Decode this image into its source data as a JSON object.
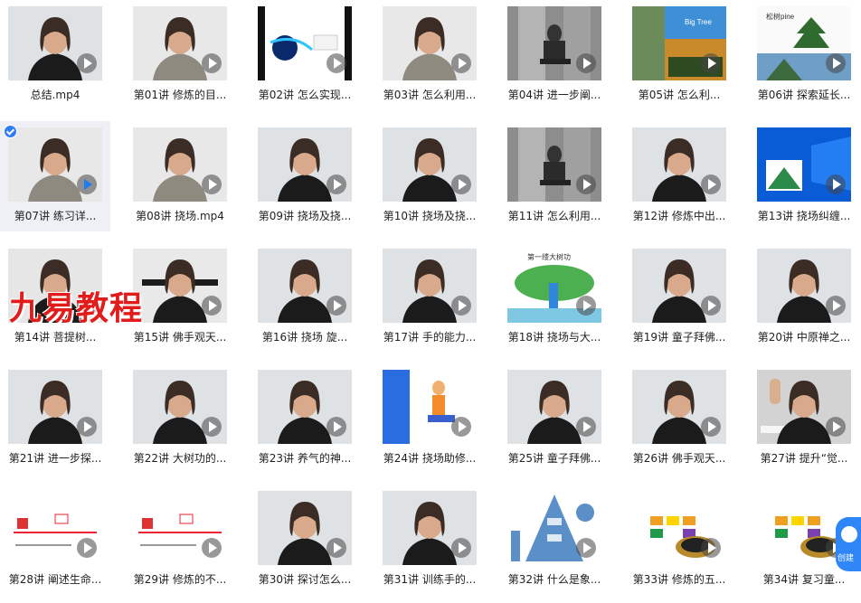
{
  "items": [
    {
      "label": "总结.mp4",
      "style": "person",
      "selected": false
    },
    {
      "label": "第01讲 修炼的目...",
      "style": "person-light",
      "selected": false
    },
    {
      "label": "第02讲 怎么实现...",
      "style": "slide-blue",
      "selected": false
    },
    {
      "label": "第03讲 怎么利用...",
      "style": "person-light",
      "selected": false
    },
    {
      "label": "第04讲 进一步阐...",
      "style": "elevator",
      "selected": false
    },
    {
      "label": "第05讲  怎么利...",
      "style": "tree-collage",
      "selected": false
    },
    {
      "label": "第06讲 探索延长...",
      "style": "pine-slide",
      "selected": false
    },
    {
      "label": "第07讲   练习详...",
      "style": "person-light",
      "selected": true
    },
    {
      "label": "第08讲 挠场.mp4",
      "style": "person-light",
      "selected": false
    },
    {
      "label": "第09讲 挠场及挠...",
      "style": "person",
      "selected": false
    },
    {
      "label": "第10讲 挠场及挠...",
      "style": "person",
      "selected": false
    },
    {
      "label": "第11讲 怎么利用...",
      "style": "elevator",
      "selected": false
    },
    {
      "label": "第12讲 修炼中出...",
      "style": "person",
      "selected": false
    },
    {
      "label": "第13讲 挠场纠缠...",
      "style": "win-desktop",
      "selected": false
    },
    {
      "label": "第14讲   菩提树...",
      "style": "person-standing",
      "selected": false
    },
    {
      "label": "第15讲 佛手观天...",
      "style": "person-arms",
      "selected": false
    },
    {
      "label": "第16讲 挠场 旋...",
      "style": "person",
      "selected": false
    },
    {
      "label": "第17讲 手的能力...",
      "style": "person",
      "selected": false
    },
    {
      "label": "第18讲 挠场与大...",
      "style": "buddha-tree",
      "selected": false
    },
    {
      "label": "第19讲 童子拜佛...",
      "style": "person",
      "selected": false
    },
    {
      "label": "第20讲 中原禅之...",
      "style": "person",
      "selected": false
    },
    {
      "label": "第21讲 进一步探...",
      "style": "person",
      "selected": false
    },
    {
      "label": "第22讲 大树功的...",
      "style": "person",
      "selected": false
    },
    {
      "label": "第23讲 养气的神...",
      "style": "person",
      "selected": false
    },
    {
      "label": "第24讲 挠场助修...",
      "style": "yoga",
      "selected": false
    },
    {
      "label": "第25讲 童子拜佛...",
      "style": "person",
      "selected": false
    },
    {
      "label": "第26讲 佛手观天...",
      "style": "person",
      "selected": false
    },
    {
      "label": "第27讲 提升“觉...",
      "style": "person-hand",
      "selected": false
    },
    {
      "label": "第28讲 阐述生命...",
      "style": "diagram-slide",
      "selected": false
    },
    {
      "label": "第29讲 修炼的不...",
      "style": "diagram-slide",
      "selected": false
    },
    {
      "label": "第30讲 探讨怎么...",
      "style": "person",
      "selected": false
    },
    {
      "label": "第31讲 训练手的...",
      "style": "person",
      "selected": false
    },
    {
      "label": "第32讲 什么是象...",
      "style": "pyramid",
      "selected": false
    },
    {
      "label": "第33讲 修炼的五...",
      "style": "table-slide",
      "selected": false
    },
    {
      "label": "第34讲   复习童...",
      "style": "table-slide",
      "selected": false
    }
  ],
  "watermark": "九易教程",
  "float_button": "创建",
  "thumb_texts": {
    "big_tree": "Big Tree",
    "pine": "松树pine",
    "slide_title_18": "第一缕大树功"
  }
}
